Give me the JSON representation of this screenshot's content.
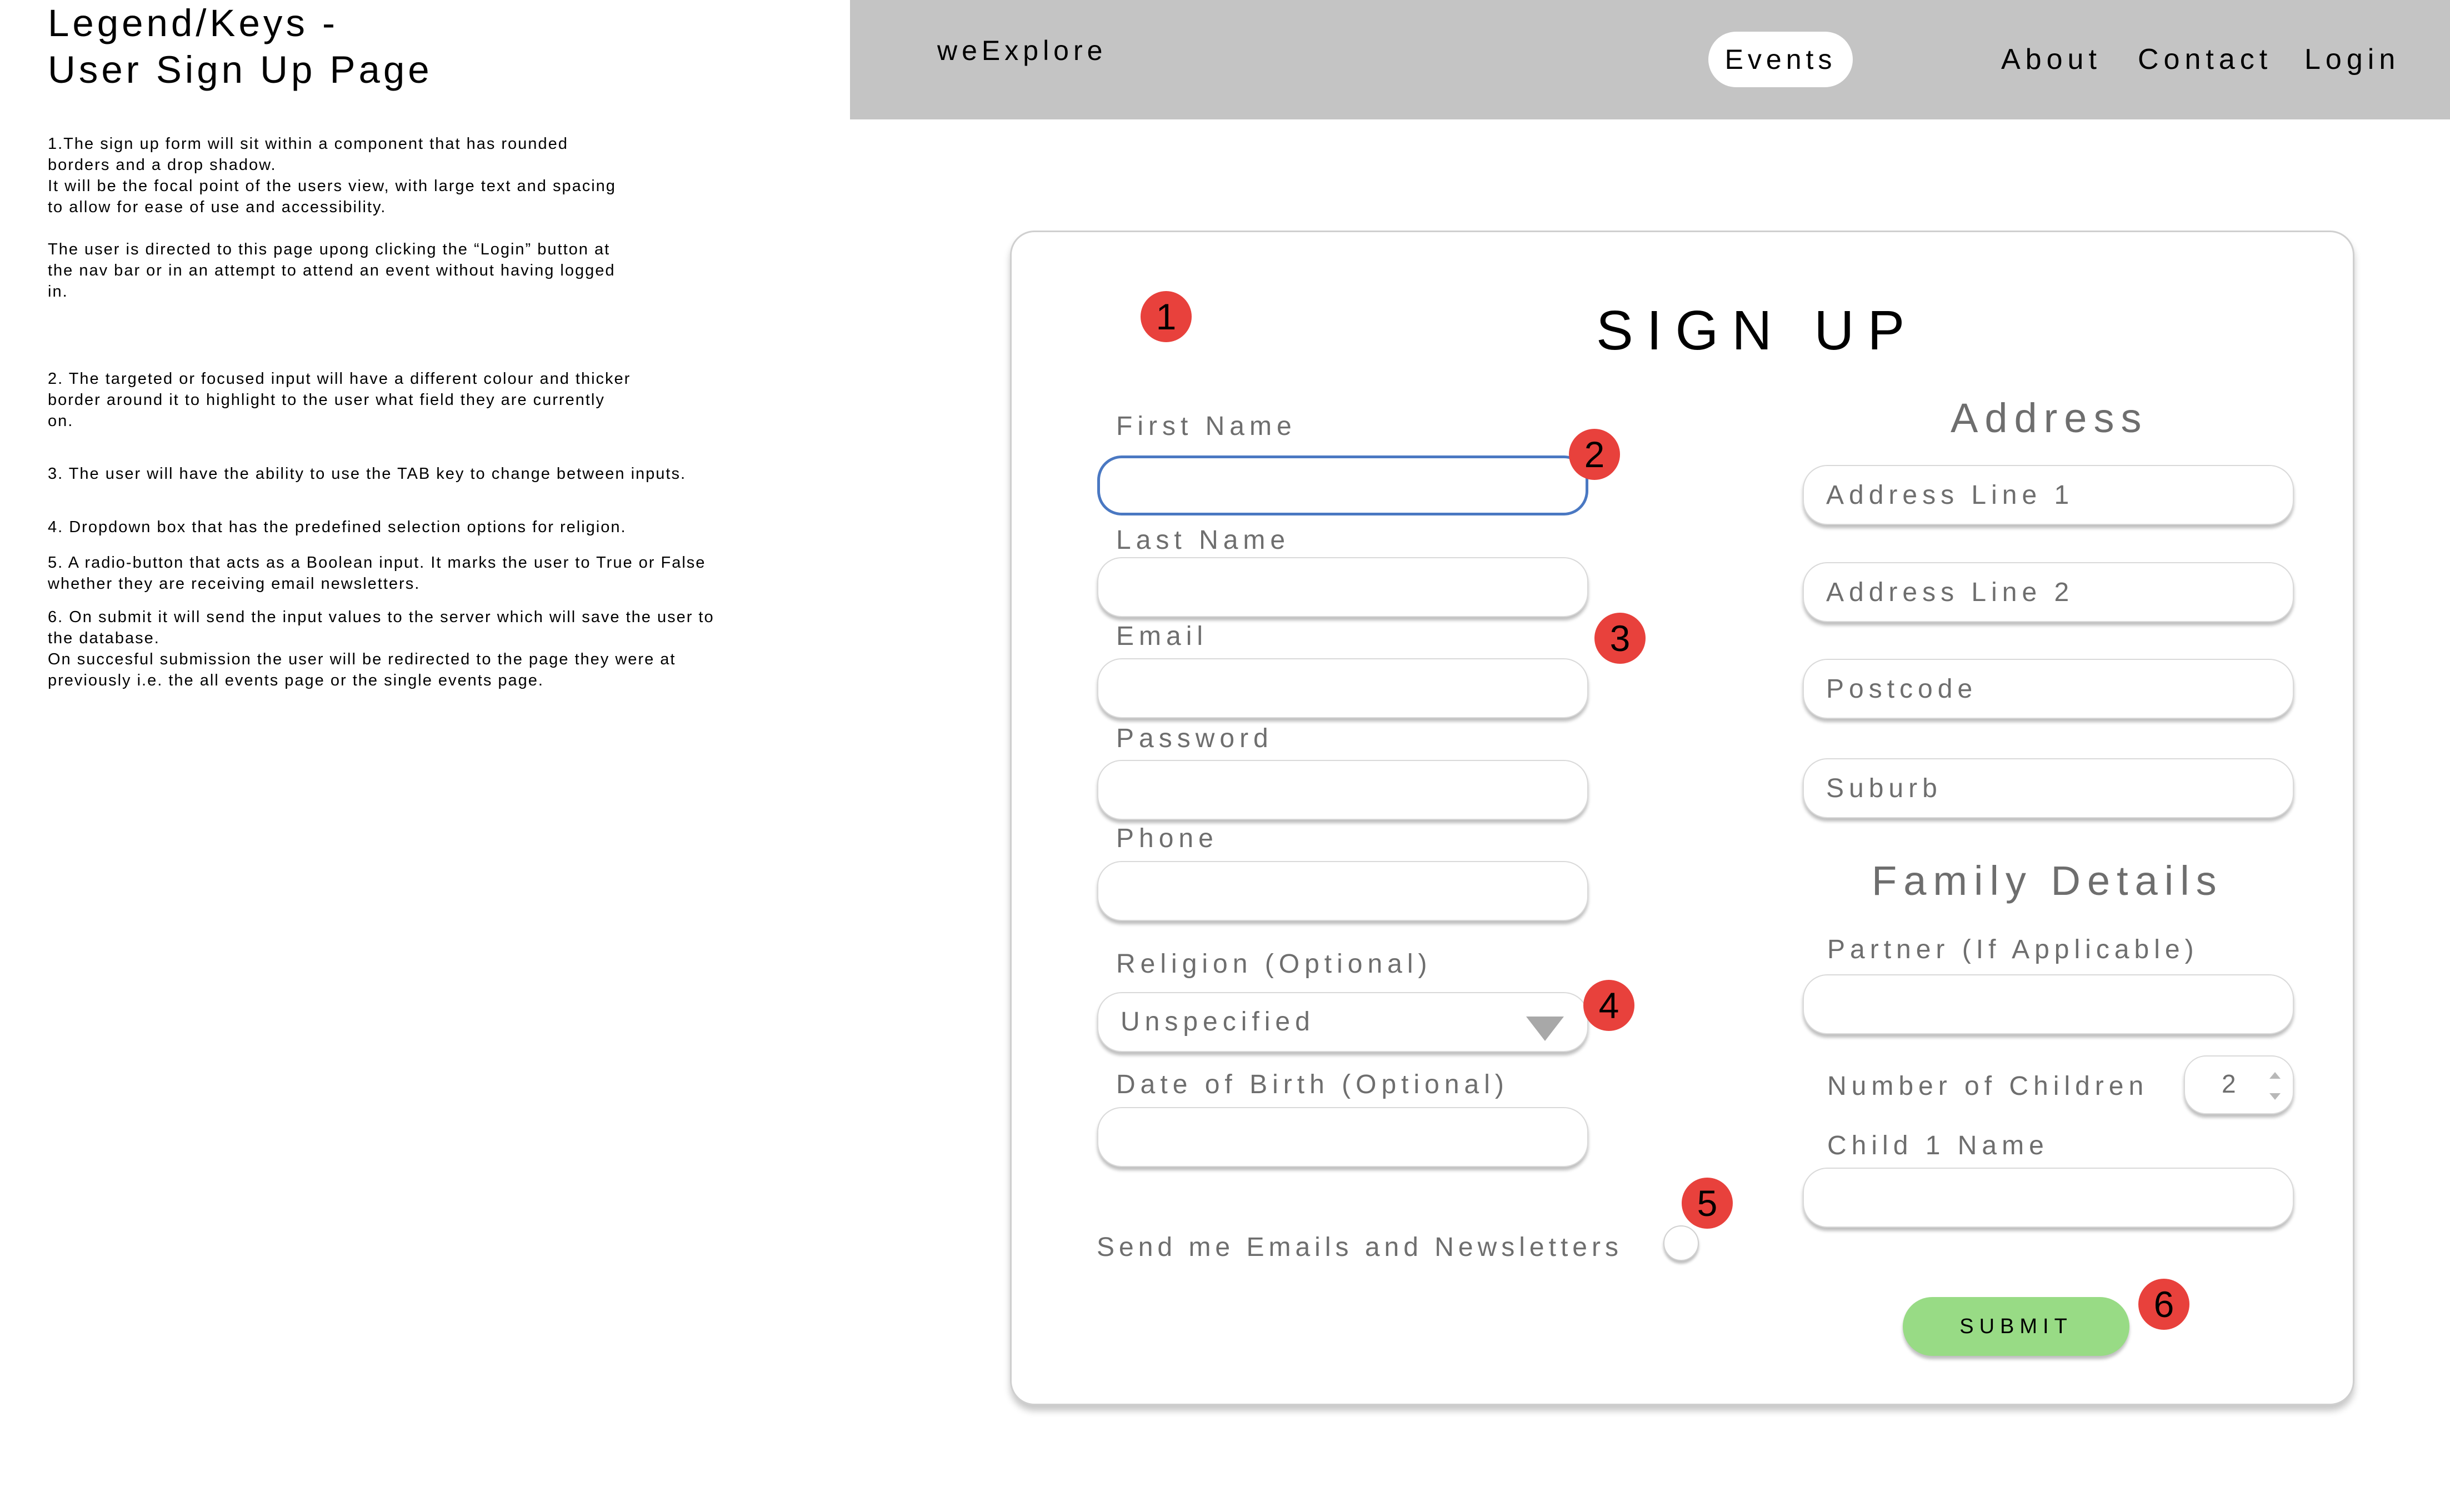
{
  "legend": {
    "title": "Legend/Keys -\nUser Sign Up Page",
    "notes": [
      "1.The sign up form will sit within a component that has rounded\nborders and a drop shadow.\nIt will be the focal point of the users view, with large text and spacing\nto allow for ease of use and accessibility.\n\nThe user is directed to this page upong clicking the “Login” button at\nthe nav bar or in an attempt to attend an event without having logged\nin.",
      "2. The targeted or focused input will have a different colour and thicker\nborder around it to highlight to the user what field they are currently\non.",
      "3. The user will have the ability to use the TAB key to change between inputs.",
      "4. Dropdown box that has the predefined selection options for religion.",
      "5. A radio-button that acts as a Boolean input. It marks the user to True or False\nwhether they are receiving email newsletters.",
      "6. On submit it will send the input values to the server which will save the user to\nthe database.\nOn succesful submission the user will be redirected to the page they were at\npreviously i.e. the all events page or the single events page."
    ]
  },
  "nav": {
    "brand": "weExplore",
    "events": "Events",
    "about": "About",
    "contact": "Contact",
    "login": "Login"
  },
  "form": {
    "title": "SIGN UP",
    "first_name_label": "First Name",
    "last_name_label": "Last Name",
    "email_label": "Email",
    "password_label": "Password",
    "phone_label": "Phone",
    "religion_label": "Religion (Optional)",
    "religion_value": "Unspecified",
    "dob_label": "Date of Birth (Optional)",
    "newsletter_label": "Send me Emails and Newsletters",
    "address_heading": "Address",
    "address_line1_placeholder": "Address Line 1",
    "address_line2_placeholder": "Address Line 2",
    "postcode_placeholder": "Postcode",
    "suburb_placeholder": "Suburb",
    "family_heading": "Family Details",
    "partner_label": "Partner (If Applicable)",
    "children_label": "Number of Children",
    "children_value": "2",
    "child1_label": "Child 1 Name",
    "submit_label": "SUBMIT"
  },
  "markers": [
    "1",
    "2",
    "3",
    "4",
    "5",
    "6"
  ],
  "colors": {
    "navbar": "#c4c4c4",
    "focus_border": "#4a78c2",
    "marker": "#e8413c",
    "submit": "#98db85"
  }
}
